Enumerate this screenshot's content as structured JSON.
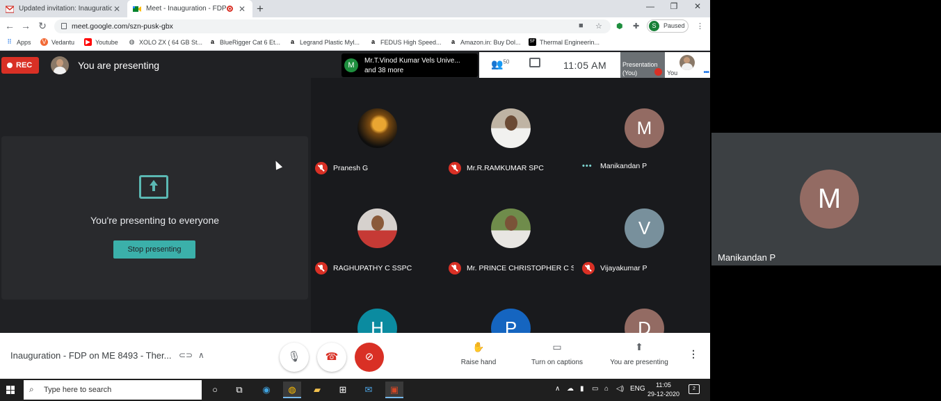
{
  "browser": {
    "tabs": [
      {
        "title": "Updated invitation: Inauguration"
      },
      {
        "title": "Meet - Inauguration - FDP o"
      }
    ],
    "new_tab": "+",
    "url": "meet.google.com/szn-pusk-gbx",
    "profile_initial": "S",
    "profile_status": "Paused",
    "bookmarks": [
      {
        "label": "Apps"
      },
      {
        "label": "Vedantu"
      },
      {
        "label": "Youtube"
      },
      {
        "label": "XOLO ZX ( 64 GB St..."
      },
      {
        "label": "BlueRigger Cat 6 Et..."
      },
      {
        "label": "Legrand Plastic Myl..."
      },
      {
        "label": "FEDUS High Speed..."
      },
      {
        "label": "Amazon.in: Buy Dol..."
      },
      {
        "label": "Thermal Engineerin..."
      }
    ]
  },
  "meet": {
    "rec_label": "REC",
    "presenting_status": "You are presenting",
    "notification": {
      "initial": "M",
      "line1": "Mr.T.Vinod Kumar Vels Unive...",
      "line2": "and 38 more"
    },
    "participant_count": "50",
    "time": "11:05 AM",
    "presentation_tile": {
      "line1": "Presentation",
      "line2": "(You)"
    },
    "self_label": "You",
    "present_panel": {
      "message": "You're presenting to everyone",
      "stop_button": "Stop presenting"
    },
    "participants": [
      {
        "name": "Pranesh G",
        "mic": "muted"
      },
      {
        "name": "Mr.R.RAMKUMAR SPC",
        "mic": "muted"
      },
      {
        "name": "Manikandan P",
        "mic": "speaking",
        "initial": "M",
        "color": "#936b63"
      },
      {
        "name": "RAGHUPATHY C SSPC",
        "mic": "muted"
      },
      {
        "name": "Mr. PRINCE CHRISTOPHER C S...",
        "mic": "muted"
      },
      {
        "name": "Vijayakumar P",
        "mic": "muted",
        "initial": "V",
        "color": "#78909c"
      },
      {
        "initial": "H",
        "color": "#0b8ba0"
      },
      {
        "initial": "P",
        "color": "#1565c0"
      },
      {
        "initial": "D",
        "color": "#936b63"
      }
    ],
    "spotlight": {
      "initial": "M",
      "name": "Manikandan P"
    },
    "meeting_title": "Inauguration - FDP on ME 8493 - Ther...",
    "controls": {
      "raise_hand": "Raise hand",
      "captions": "Turn on captions",
      "present": "You are presenting"
    }
  },
  "taskbar": {
    "search_placeholder": "Type here to search",
    "language": "ENG",
    "clock_time": "11:05",
    "clock_date": "29-12-2020",
    "notification_count": "2"
  },
  "colors": {
    "rec_red": "#d93025",
    "meet_teal": "#3bb0aa",
    "meet_bg": "#202124"
  }
}
